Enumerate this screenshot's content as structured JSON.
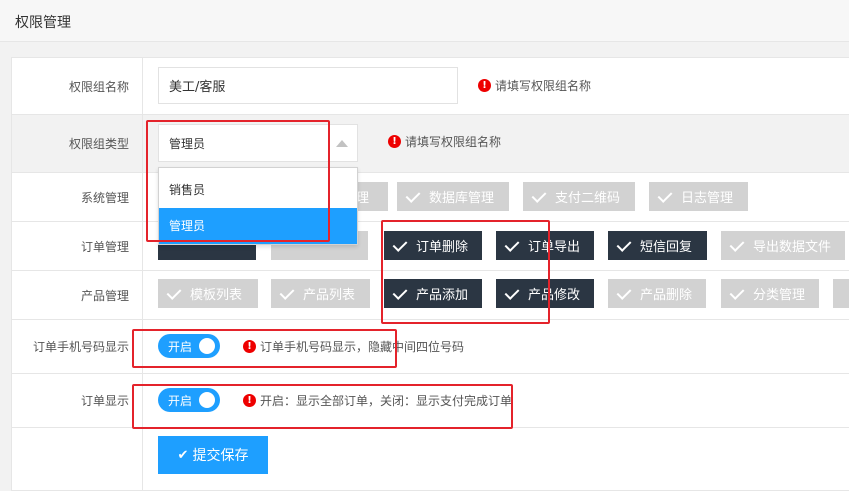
{
  "header": {
    "title": "权限管理"
  },
  "form": {
    "group_name": {
      "label": "权限组名称",
      "value": "美工/客服",
      "hint": "请填写权限组名称"
    },
    "group_type": {
      "label": "权限组类型",
      "selected": "管理员",
      "hint": "请填写权限组名称",
      "options": [
        "销售员",
        "管理员"
      ]
    },
    "system": {
      "label": "系统管理",
      "tags": [
        {
          "label": "理",
          "checked": false
        },
        {
          "label": "数据库管理",
          "checked": false
        },
        {
          "label": "支付二维码",
          "checked": false
        },
        {
          "label": "日志管理",
          "checked": false
        }
      ]
    },
    "orders": {
      "label": "订单管理",
      "tags": [
        {
          "label": "订单删除",
          "checked": true
        },
        {
          "label": "订单导出",
          "checked": true
        },
        {
          "label": "短信回复",
          "checked": true
        },
        {
          "label": "导出数据文件",
          "checked": false
        }
      ]
    },
    "products": {
      "label": "产品管理",
      "tags": [
        {
          "label": "模板列表",
          "checked": false
        },
        {
          "label": "产品列表",
          "checked": false
        },
        {
          "label": "产品添加",
          "checked": true
        },
        {
          "label": "产品修改",
          "checked": true
        },
        {
          "label": "产品删除",
          "checked": false
        },
        {
          "label": "分类管理",
          "checked": false
        }
      ]
    },
    "phone_display": {
      "label": "订单手机号码显示",
      "switch_label": "开启",
      "hint": "订单手机号码显示，隐藏中间四位号码"
    },
    "order_display": {
      "label": "订单显示",
      "switch_label": "开启",
      "hint": "开启：显示全部订单，关闭：显示支付完成订单"
    },
    "submit": {
      "label": "提交保存"
    }
  },
  "colors": {
    "accent": "#1e9fff",
    "checked_tag": "#2b3643",
    "unchecked_tag": "#d2d2d2",
    "error": "#e00000",
    "annotation": "#e4232b"
  }
}
